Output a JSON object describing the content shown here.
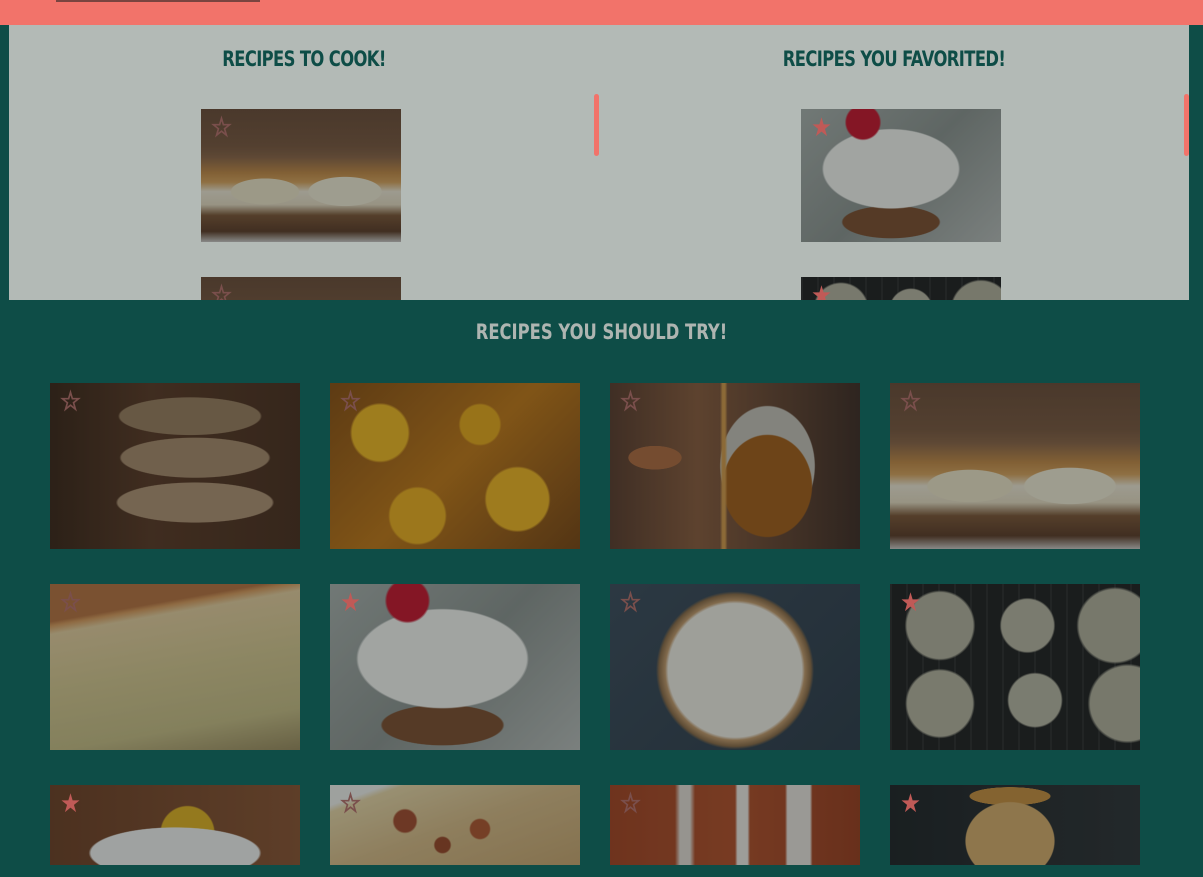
{
  "header": {
    "background": "#f2736a"
  },
  "to_cook": {
    "title": "RECIPES TO COOK!",
    "cards": [
      {
        "image": "pancake-banana-stack",
        "star": "outline"
      },
      {
        "image": "pancake-banana-stack",
        "star": "outline"
      }
    ]
  },
  "favorited": {
    "title": "RECIPES YOU FAVORITED!",
    "cards": [
      {
        "image": "coconut-cherry-cupcake",
        "star": "filled"
      },
      {
        "image": "cookies-on-rack",
        "star": "filled"
      }
    ]
  },
  "should_try": {
    "title": "RECIPES YOU SHOULD TRY!",
    "tiles": [
      {
        "image": "stacked-cookies",
        "star": "outline"
      },
      {
        "image": "glazed-peaches",
        "star": "outline"
      },
      {
        "image": "caramel-sauce-jar",
        "star": "outline"
      },
      {
        "image": "pancake-banana-stack",
        "star": "outline"
      },
      {
        "image": "sliced-bread",
        "star": "outline"
      },
      {
        "image": "coconut-cherry-cupcake",
        "star": "filled"
      },
      {
        "image": "chocolate-banana-tart",
        "star": "outline"
      },
      {
        "image": "cookies-on-rack",
        "star": "filled"
      },
      {
        "image": "salad-plate",
        "star": "filled"
      },
      {
        "image": "pizza",
        "star": "outline"
      },
      {
        "image": "hot-sauce-bottles",
        "star": "outline"
      },
      {
        "image": "smoothie-jar",
        "star": "filled"
      }
    ]
  },
  "colors": {
    "teal": "#0e4d47",
    "coral": "#f2736a",
    "panel": "#b3bab6"
  }
}
